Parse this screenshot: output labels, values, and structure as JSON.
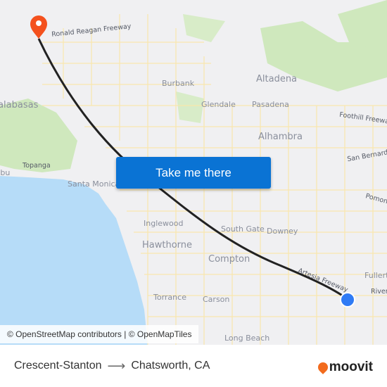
{
  "map": {
    "labels": [
      {
        "text": "Ronald Reagan Freeway",
        "kind": "road"
      },
      {
        "text": "Burbank",
        "kind": "city"
      },
      {
        "text": "Altadena",
        "kind": "city-big"
      },
      {
        "text": "Glendale",
        "kind": "city"
      },
      {
        "text": "Pasadena",
        "kind": "city"
      },
      {
        "text": "Calabasas",
        "kind": "city-big"
      },
      {
        "text": "Foothill Freeway",
        "kind": "road"
      },
      {
        "text": "Alhambra",
        "kind": "city-big"
      },
      {
        "text": "Topanga",
        "kind": "city-small"
      },
      {
        "text": "San Bernardino",
        "kind": "road"
      },
      {
        "text": "Santa Monica",
        "kind": "city"
      },
      {
        "text": "Pomona",
        "kind": "road"
      },
      {
        "text": "Inglewood",
        "kind": "city"
      },
      {
        "text": "South Gate",
        "kind": "city"
      },
      {
        "text": "Downey",
        "kind": "city"
      },
      {
        "text": "Hawthorne",
        "kind": "city-big"
      },
      {
        "text": "Compton",
        "kind": "city-big"
      },
      {
        "text": "Fullerton",
        "kind": "city"
      },
      {
        "text": "Artesia Freeway",
        "kind": "road"
      },
      {
        "text": "Riverside",
        "kind": "road"
      },
      {
        "text": "Torrance",
        "kind": "city"
      },
      {
        "text": "Carson",
        "kind": "city"
      },
      {
        "text": "Long Beach",
        "kind": "city"
      },
      {
        "text": "Malibu",
        "kind": "city"
      }
    ],
    "origin_marker_color": "#2f7bf5",
    "destination_marker_color": "#f4511e",
    "route_color": "#222222"
  },
  "cta": {
    "label": "Take me there"
  },
  "attribution": "© OpenStreetMap contributors | © OpenMapTiles",
  "footer": {
    "origin": "Crescent-Stanton",
    "arrow": "⟶",
    "destination": "Chatsworth, CA",
    "brand": "moovit",
    "brand_color": "#f26b1d"
  }
}
